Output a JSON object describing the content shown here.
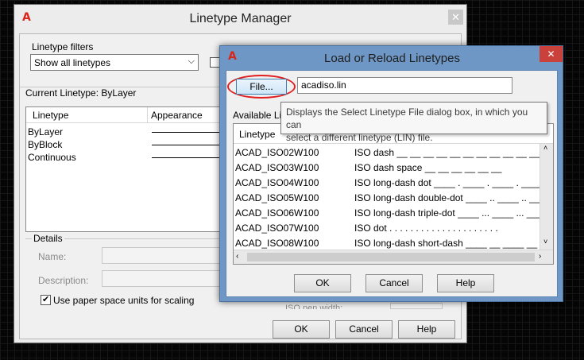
{
  "linetype_manager": {
    "title": "Linetype Manager",
    "filters_label": "Linetype filters",
    "filter_value": "Show all linetypes",
    "current_linetype_label": "Current Linetype:",
    "current_linetype_value": "ByLayer",
    "columns": [
      "Linetype",
      "Appearance"
    ],
    "rows": [
      "ByLayer",
      "ByBlock",
      "Continuous"
    ],
    "details_label": "Details",
    "name_label": "Name:",
    "description_label": "Description:",
    "paper_space_label": "Use paper space units for scaling",
    "iso_pen_label": "ISO pen width:",
    "ok": "OK",
    "cancel": "Cancel",
    "help": "Help"
  },
  "load_dialog": {
    "title": "Load or Reload Linetypes",
    "file_button": "File...",
    "file_value": "acadiso.lin",
    "available_label": "Available Line",
    "tooltip_line1": "Displays the Select Linetype File dialog box, in which you can",
    "tooltip_line2": "select a different linetype (LIN) file.",
    "column_linetype": "Linetype",
    "rows": [
      {
        "name": "ACAD_ISO02W100",
        "desc": "ISO dash __ __ __ __ __ __ __ __ __ __ __ __ __",
        "pattern": "dash"
      },
      {
        "name": "ACAD_ISO03W100",
        "desc": "ISO dash space __    __    __    __    __    __",
        "pattern": "dashspace"
      },
      {
        "name": "ACAD_ISO04W100",
        "desc": "ISO long-dash dot ____ . ____ . ____ . ____ . __",
        "pattern": "longdot"
      },
      {
        "name": "ACAD_ISO05W100",
        "desc": "ISO long-dash double-dot ____ .. ____ .. ____ .",
        "pattern": "double"
      },
      {
        "name": "ACAD_ISO06W100",
        "desc": "ISO long-dash triple-dot ____ ... ____ ... ____",
        "pattern": "triple"
      },
      {
        "name": "ACAD_ISO07W100",
        "desc": "ISO dot . . . . . . . . . . . . . . . . . . . . .",
        "pattern": "dot"
      },
      {
        "name": "ACAD_ISO08W100",
        "desc": "ISO long-dash short-dash ____ __ ____ __ ____ _",
        "pattern": "shortdash"
      }
    ],
    "ok": "OK",
    "cancel": "Cancel",
    "help": "Help"
  },
  "colors": {
    "highlight_ellipse": "#e02020",
    "dialog_frame": "#6e97c6",
    "close_button": "#c9413a"
  },
  "icons": [
    "autocad-logo-icon",
    "close-icon",
    "chevron-down-icon",
    "checkmark-icon",
    "scroll-up-icon",
    "scroll-down-icon",
    "scroll-left-icon",
    "scroll-right-icon"
  ]
}
